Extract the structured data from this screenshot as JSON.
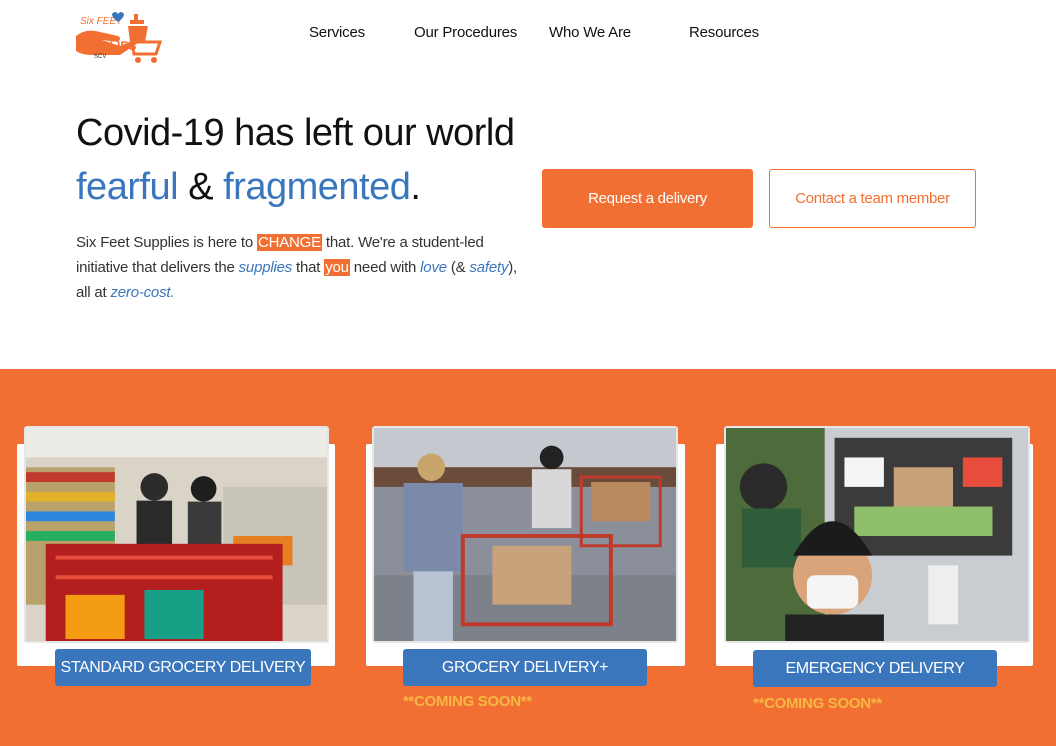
{
  "logo": {
    "line1": "Six FEET",
    "line2": "SUPPLIES",
    "line3": "SCV",
    "icon": "hand-cart-logo-icon"
  },
  "nav": {
    "items": [
      {
        "label": "Services"
      },
      {
        "label": "Our Procedures"
      },
      {
        "label": "Who We Are"
      },
      {
        "label": "Resources"
      }
    ]
  },
  "hero": {
    "line1": "Covid-19 has left our world",
    "word_fearful": "fearful",
    "amp": "&",
    "word_fragmented": "fragmented",
    "period": "."
  },
  "intro": {
    "p1": "Six Feet Supplies is here to ",
    "change": "CHANGE",
    "p2": " that. We're a student-led initiative that delivers the ",
    "supplies": "supplies",
    "p3": "  that ",
    "you": "you",
    "p4": " need with ",
    "love": "love",
    "p5": " (& ",
    "safety": "safety",
    "p6": "), all at ",
    "zero_cost": "zero-cost."
  },
  "buttons": {
    "request": "Request a delivery",
    "contact": "Contact a team member"
  },
  "cards": [
    {
      "label": "STANDARD GROCERY DELIVERY",
      "note": ""
    },
    {
      "label": "GROCERY DELIVERY+",
      "note": "**COMING SOON**"
    },
    {
      "label": "EMERGENCY DELIVERY",
      "note": "**COMING SOON**"
    }
  ],
  "colors": {
    "orange": "#f26f33",
    "blue": "#3a76bb",
    "yellow": "#f5b843"
  }
}
